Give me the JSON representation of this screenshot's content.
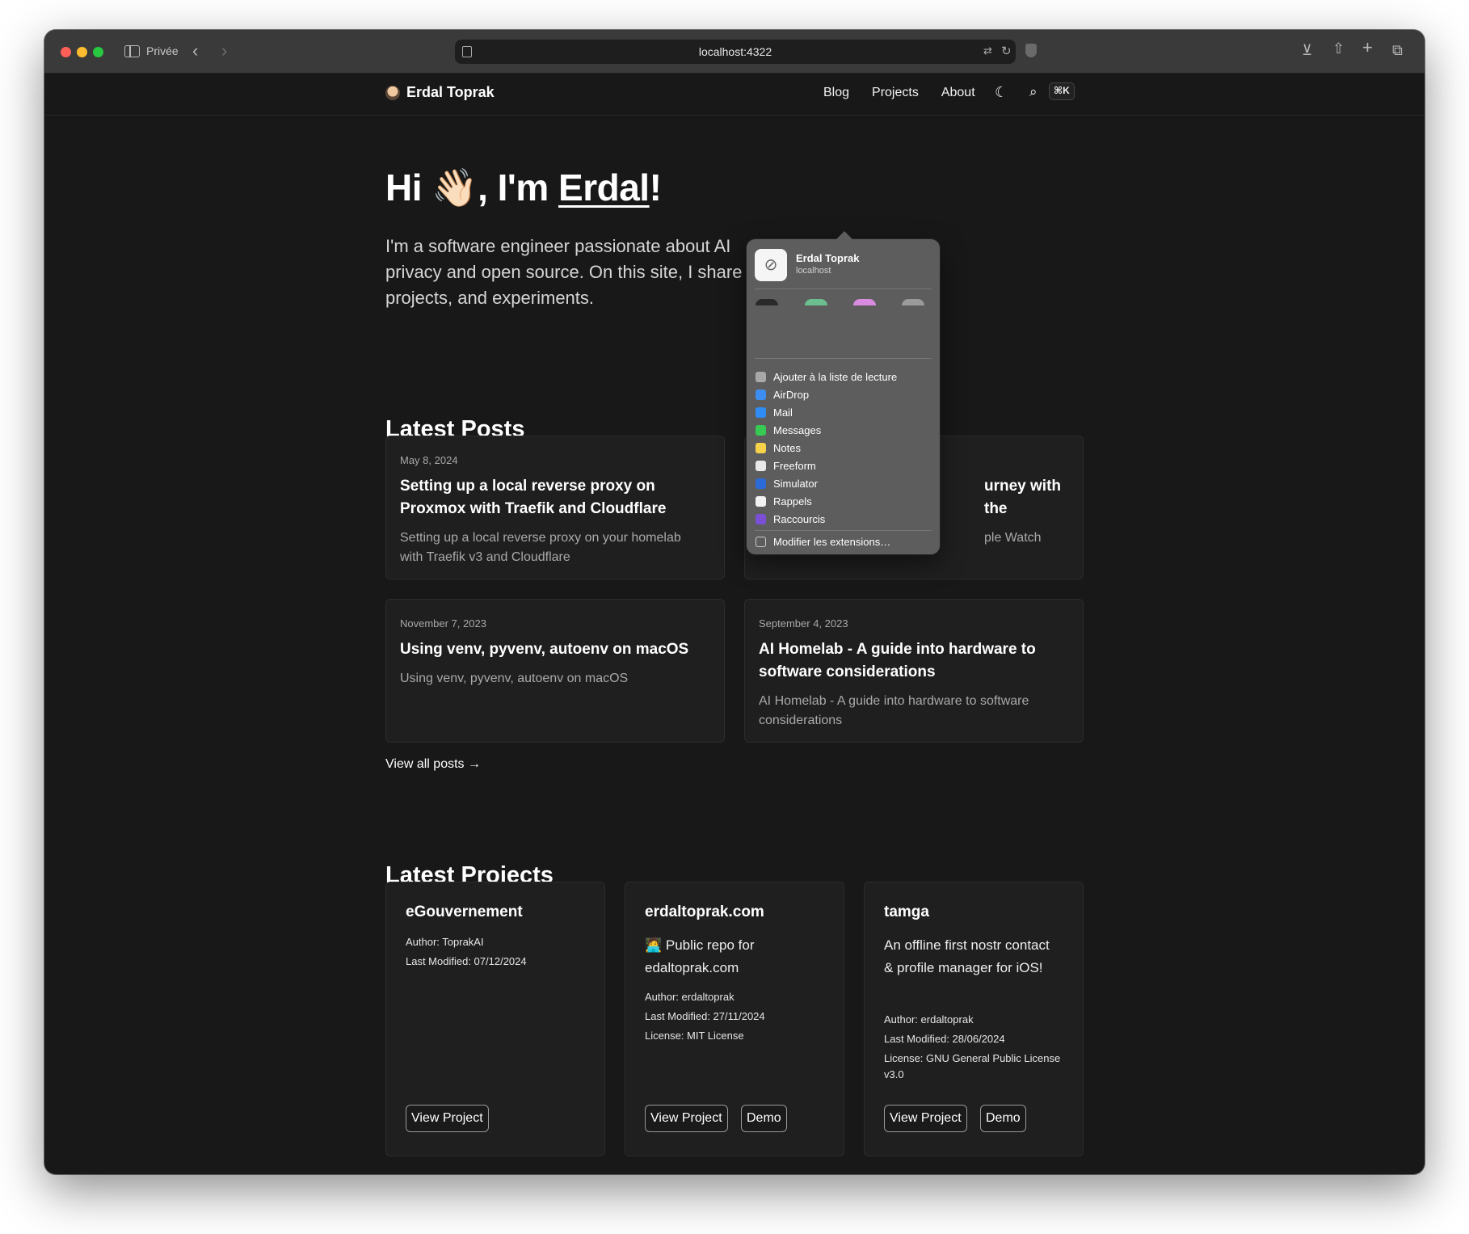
{
  "browser": {
    "private_label": "Privée",
    "url": "localhost:4322"
  },
  "site": {
    "brand": "Erdal Toprak",
    "nav": [
      "Blog",
      "Projects",
      "About"
    ],
    "shortcut": "⌘K"
  },
  "hero": {
    "greeting_prefix": "Hi ",
    "wave": "👋🏻",
    "greeting_mid": ", I'm ",
    "name": "Erdal",
    "greeting_suffix": "!",
    "intro_lines": [
      "I'm a software engineer passionate about AI",
      "privacy and open source. On this site, I share",
      "projects, and experiments."
    ]
  },
  "posts": {
    "section_title": "Latest Posts",
    "items": [
      {
        "date": "May 8, 2024",
        "title": "Setting up a local reverse proxy on Proxmox with Traefik and Cloudflare",
        "desc": "Setting up a local reverse proxy on your homelab with Traefik v3 and Cloudflare"
      },
      {
        "title_fragment": "urney with the",
        "desc_fragment": "ple Watch"
      },
      {
        "date": "November 7, 2023",
        "title": "Using venv, pyvenv, autoenv on macOS",
        "desc": "Using venv, pyvenv, autoenv on macOS"
      },
      {
        "date": "September 4, 2023",
        "title": "AI Homelab - A guide into hardware to software considerations",
        "desc": "AI Homelab - A guide into hardware to software considerations"
      }
    ],
    "view_all": "View all posts →"
  },
  "projects": {
    "section_title": "Latest Projects",
    "items": [
      {
        "name": "eGouvernement",
        "author": "Author: ToprakAI",
        "modified": "Last Modified: 07/12/2024",
        "buttons": [
          "View Project"
        ]
      },
      {
        "name": "erdaltoprak.com",
        "desc": "🧑‍💻 Public repo for edaltoprak.com",
        "author": "Author: erdaltoprak",
        "modified": "Last Modified: 27/11/2024",
        "license": "License: MIT License",
        "buttons": [
          "View Project",
          "Demo"
        ]
      },
      {
        "name": "tamga",
        "desc": "An offline first nostr contact & profile manager for iOS!",
        "author": "Author: erdaltoprak",
        "modified": "Last Modified: 28/06/2024",
        "license": "License: GNU General Public License v3.0",
        "buttons": [
          "View Project",
          "Demo"
        ]
      }
    ]
  },
  "share_popup": {
    "site_title": "Erdal Toprak",
    "site_host": "localhost",
    "contact_colors": [
      "#2a2a2a",
      "#6bbf8e",
      "#d98be0",
      "#9a9a9a"
    ],
    "items": [
      {
        "label": "Ajouter à la liste de lecture",
        "icon": "reading-list-icon",
        "color": "#a8a8a8"
      },
      {
        "label": "AirDrop",
        "icon": "airdrop-icon",
        "color": "#3d8ef0"
      },
      {
        "label": "Mail",
        "icon": "mail-icon",
        "color": "#2f8cf5"
      },
      {
        "label": "Messages",
        "icon": "messages-icon",
        "color": "#37c952"
      },
      {
        "label": "Notes",
        "icon": "notes-icon",
        "color": "#f5d24a"
      },
      {
        "label": "Freeform",
        "icon": "freeform-icon",
        "color": "#e8e8e8"
      },
      {
        "label": "Simulator",
        "icon": "simulator-icon",
        "color": "#2c6ad6"
      },
      {
        "label": "Rappels",
        "icon": "reminders-icon",
        "color": "#f2f2f2"
      },
      {
        "label": "Raccourcis",
        "icon": "shortcuts-icon",
        "color": "#7a4fd6"
      }
    ],
    "footer": "Modifier les extensions…"
  }
}
